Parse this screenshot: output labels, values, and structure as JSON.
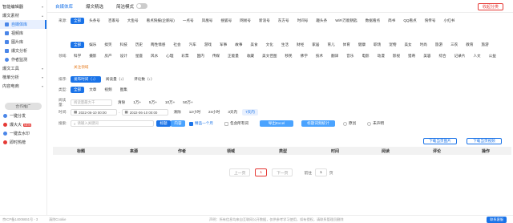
{
  "sidebar": {
    "groups": [
      {
        "label": "智能编辑器"
      },
      {
        "label": "爆文素材"
      }
    ],
    "items": [
      {
        "label": "自媒体库",
        "active": true
      },
      {
        "label": "视频库"
      },
      {
        "label": "图片库"
      },
      {
        "label": "爆文分析"
      },
      {
        "label": "作者监测"
      }
    ],
    "groups2": [
      {
        "label": "爆文工具"
      },
      {
        "label": "榜单分析"
      },
      {
        "label": "内容电商"
      }
    ],
    "partner_label": "合作推广",
    "partners": [
      {
        "label": "一键分发",
        "color": "#4a86e8"
      },
      {
        "label": "爆大大",
        "color": "#e53935",
        "badge": "NEW"
      },
      {
        "label": "一键去水印",
        "color": "#4a86e8"
      },
      {
        "label": "即时热榜",
        "color": "#e53935"
      }
    ]
  },
  "topbar": {
    "tabs": [
      "自媒体库",
      "爆文精选",
      "简洁模式"
    ],
    "collect_label": "收起分类"
  },
  "filters": {
    "source_label": "来源:",
    "sources": [
      "全部",
      "头条号",
      "百家号",
      "大鱼号",
      "看点快报(企鹅号)",
      "一点号",
      "凤凰号",
      "搜狐号",
      "网易号",
      "新浪号",
      "东方号",
      "时间号",
      "趣头条",
      "WiFi万能钥匙",
      "数据看点",
      "简书",
      "QQ看点",
      "快传号",
      "小红书"
    ],
    "field_label": "领域:",
    "fields": [
      "全部",
      "娱乐",
      "搞笑",
      "科技",
      "历史",
      "两性情感",
      "社会",
      "汽车",
      "游戏",
      "军事",
      "故事",
      "美食",
      "文化",
      "生活",
      "财经",
      "家居",
      "育儿",
      "体育",
      "健康",
      "职场",
      "宠物",
      "美女",
      "时尚",
      "旅游",
      "三农",
      "教育",
      "旅游",
      "科学",
      "摄影",
      "房产",
      "设计",
      "星座",
      "风水",
      "心理",
      "彩票",
      "国内",
      "传媒",
      "正能量",
      "收藏",
      "美文佳图",
      "移民",
      "佛学",
      "技术",
      "翻译",
      "音乐",
      "电影",
      "动漫",
      "影视",
      "猎奇",
      "美容",
      "综合",
      "记录片",
      "人文",
      "公益",
      "关注领域"
    ],
    "sort_label": "排序:",
    "sorts": [
      "发布时间（↓）",
      "阅读量（↓）",
      "评论数（↓）"
    ],
    "type_label": "类型:",
    "types": [
      "全部",
      "文章",
      "视频",
      "图集"
    ],
    "read_label": "阅读量:",
    "read_placeholder": "阅读量最大千",
    "read_clear": "清除",
    "reads": [
      "1万+",
      "5万+",
      "10万+",
      "50万+"
    ],
    "time_label": "时间:",
    "date_from": "2022-06-10 00:00",
    "date_to": "2022-06-10 00:00",
    "time_clear": "清除",
    "times": [
      "12小时",
      "24小时",
      "3天内",
      "7天内"
    ],
    "search_label": "搜索:",
    "search_placeholder": "请输入关键词",
    "title_btn": "标题",
    "content_btn": "内容",
    "precise_label": "精品一个月",
    "include_all": "包含所有词",
    "export_btn": "导出Excel",
    "stats_btn": "标题词频统计",
    "original_label": "原创",
    "not_published_label": "未声明"
  },
  "table": {
    "actions": [
      "下载当页图片",
      "下载当页视频"
    ],
    "headers": [
      "标题",
      "来源",
      "作者",
      "领域",
      "类型",
      "时间",
      "阅读",
      "评论",
      "操作"
    ]
  },
  "pager": {
    "prev": "上一页",
    "current": "1",
    "next": "下一页",
    "goto_label": "前往",
    "goto_value": "1",
    "page_suffix": "页"
  },
  "footer": {
    "icp": "京ICP备14006651号 - 3",
    "cookie": "清除Cookie",
    "notice": "声明：所有信息均来自互联网公开数据，仅供参考学习使用，如有侵权，请联系管理员删除",
    "contact": "联系客服"
  }
}
